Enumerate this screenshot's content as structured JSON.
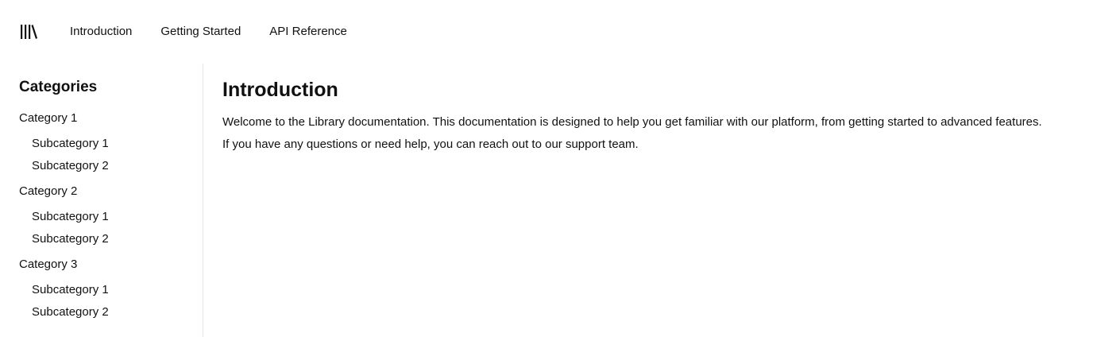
{
  "header": {
    "logo_icon": "library-books-icon",
    "nav": [
      {
        "label": "Introduction"
      },
      {
        "label": "Getting Started"
      },
      {
        "label": "API Reference"
      }
    ]
  },
  "sidebar": {
    "title": "Categories",
    "categories": [
      {
        "label": "Category 1",
        "subcategories": [
          {
            "label": "Subcategory 1"
          },
          {
            "label": "Subcategory 2"
          }
        ]
      },
      {
        "label": "Category 2",
        "subcategories": [
          {
            "label": "Subcategory 1"
          },
          {
            "label": "Subcategory 2"
          }
        ]
      },
      {
        "label": "Category 3",
        "subcategories": [
          {
            "label": "Subcategory 1"
          },
          {
            "label": "Subcategory 2"
          }
        ]
      }
    ]
  },
  "main": {
    "title": "Introduction",
    "paragraphs": [
      "Welcome to the Library documentation. This documentation is designed to help you get familiar with our platform, from getting started to advanced features.",
      "If you have any questions or need help, you can reach out to our support team."
    ]
  }
}
